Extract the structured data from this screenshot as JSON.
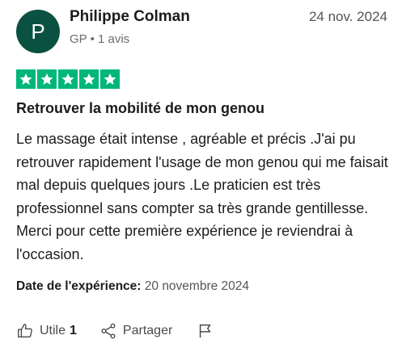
{
  "review": {
    "author": {
      "initial": "P",
      "name": "Philippe Colman",
      "country": "GP",
      "review_count": "1 avis",
      "avatar_color": "#0b5141"
    },
    "date": "24 nov. 2024",
    "rating": 5,
    "star_color": "#00b67a",
    "title": "Retrouver la mobilité de mon genou",
    "body": "Le massage était intense , agréable et précis .J'ai pu retrouver rapidement l'usage de mon genou qui me faisait mal depuis quelques jours .Le praticien est très professionnel sans compter sa très grande gentillesse. Merci pour cette première expérience je reviendrai à l'occasion.",
    "experience_label": "Date de l'expérience:",
    "experience_date": "20 novembre 2024"
  },
  "actions": {
    "useful_label": "Utile",
    "useful_count": "1",
    "share_label": "Partager",
    "useful_icon": "thumbs-up-icon",
    "share_icon": "share-icon",
    "report_icon": "flag-icon"
  }
}
